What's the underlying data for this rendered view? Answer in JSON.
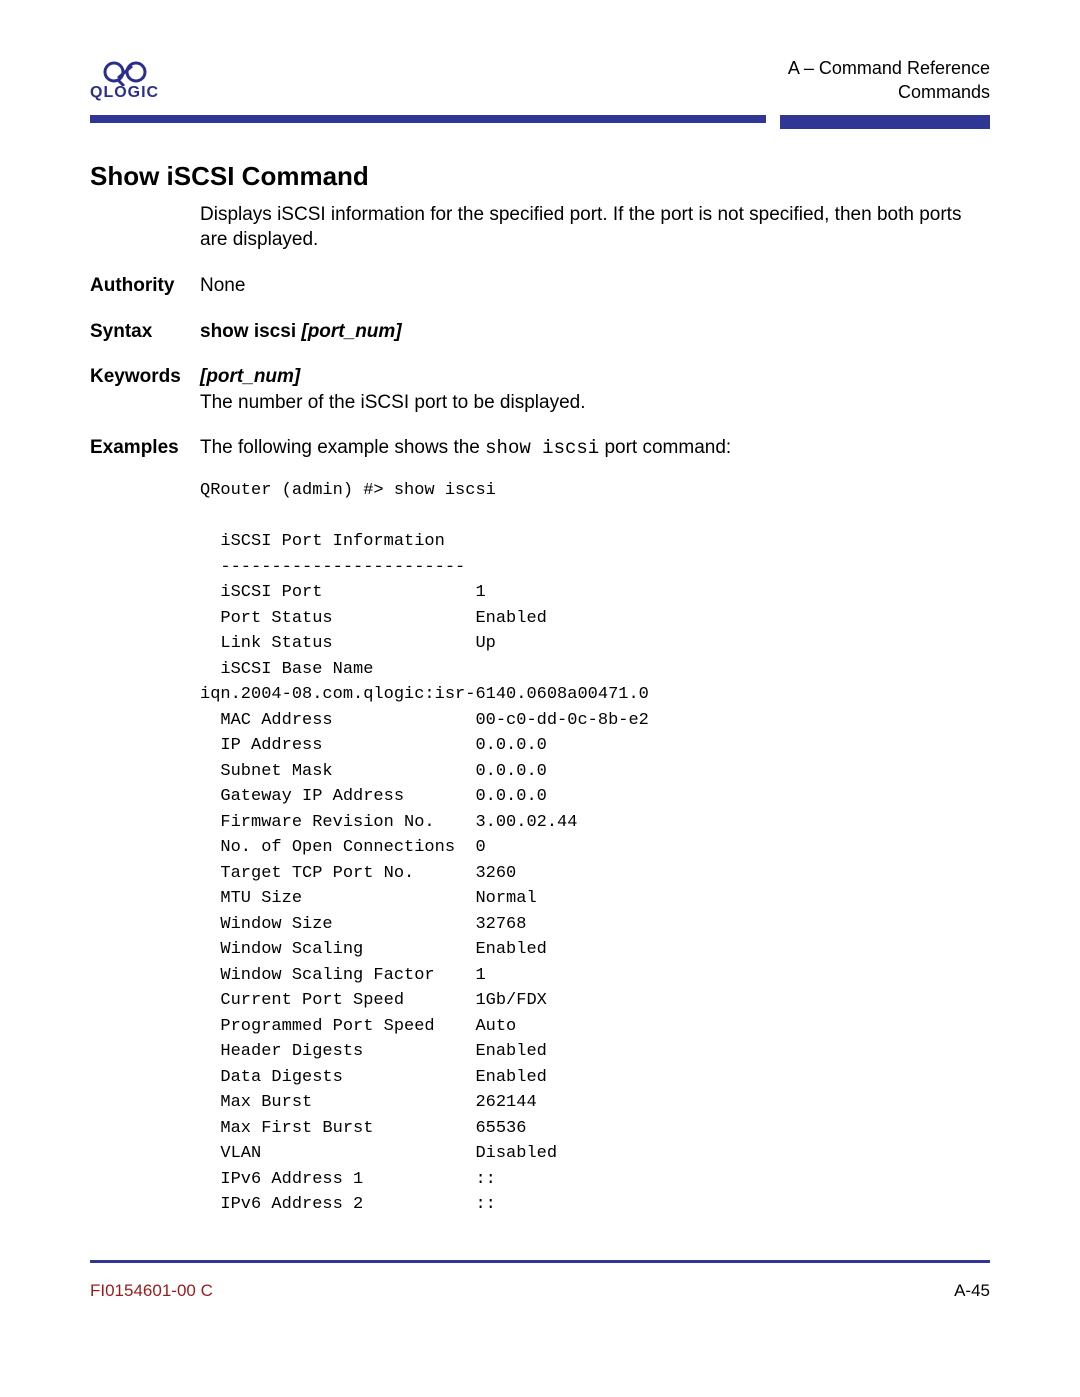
{
  "header": {
    "logo_text": "QLOGIC",
    "right_line1": "A – Command Reference",
    "right_line2": "Commands"
  },
  "title": "Show iSCSI Command",
  "intro": "Displays iSCSI information for the specified port. If the port is not specified, then both ports are displayed.",
  "authority": {
    "label": "Authority",
    "value": "None"
  },
  "syntax": {
    "label": "Syntax",
    "cmd": "show  iscsi ",
    "param": "[port_num]"
  },
  "keywords": {
    "label": "Keywords",
    "param": "[port_num]",
    "desc": "The number of the iSCSI port to be displayed."
  },
  "examples": {
    "label": "Examples",
    "sentence_before": "The following example shows the ",
    "sentence_code": "show iscsi",
    "sentence_after": " port command:"
  },
  "terminal": "QRouter (admin) #> show iscsi\n\n  iSCSI Port Information\n  ------------------------\n  iSCSI Port               1\n  Port Status              Enabled\n  Link Status              Up\n  iSCSI Base Name\niqn.2004-08.com.qlogic:isr-6140.0608a00471.0\n  MAC Address              00-c0-dd-0c-8b-e2\n  IP Address               0.0.0.0\n  Subnet Mask              0.0.0.0\n  Gateway IP Address       0.0.0.0\n  Firmware Revision No.    3.00.02.44\n  No. of Open Connections  0\n  Target TCP Port No.      3260\n  MTU Size                 Normal\n  Window Size              32768\n  Window Scaling           Enabled\n  Window Scaling Factor    1\n  Current Port Speed       1Gb/FDX\n  Programmed Port Speed    Auto\n  Header Digests           Enabled\n  Data Digests             Enabled\n  Max Burst                262144\n  Max First Burst          65536\n  VLAN                     Disabled\n  IPv6 Address 1           ::\n  IPv6 Address 2           ::",
  "footer": {
    "left": "FI0154601-00  C",
    "right": "A-45"
  }
}
